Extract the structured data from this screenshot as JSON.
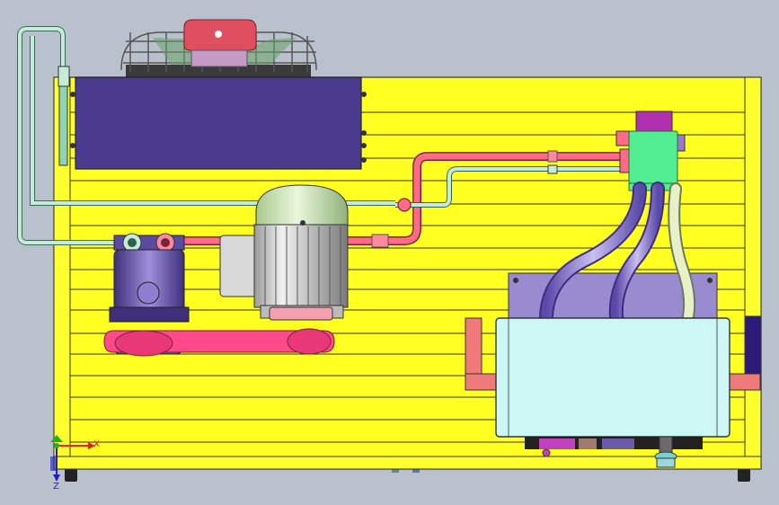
{
  "axes": {
    "x_label": "X",
    "y_label": "Y",
    "z_label": "Z"
  },
  "colors": {
    "background": "#b7c0cb",
    "frame": "#ffff22",
    "frame_slat_line": "#333333",
    "condenser": "#4a3b8f",
    "compressor": "#6a5aa8",
    "motor_fins": "#dcdcdc",
    "motor_cap": "#cfe8b8",
    "belt": "#ff4a8a",
    "hot_pipe": "#ff6b86",
    "cold_pipe": "#c6ecd9",
    "tank": "#ccf7f5",
    "accumulator": "#50ee90",
    "flex_hose": "#7e6ec8",
    "bracket": "#f07a7a",
    "fan_grille": "#555555",
    "fan_hub": "#e04f60"
  },
  "icons": [
    "axis-triad-icon",
    "fan-icon"
  ]
}
